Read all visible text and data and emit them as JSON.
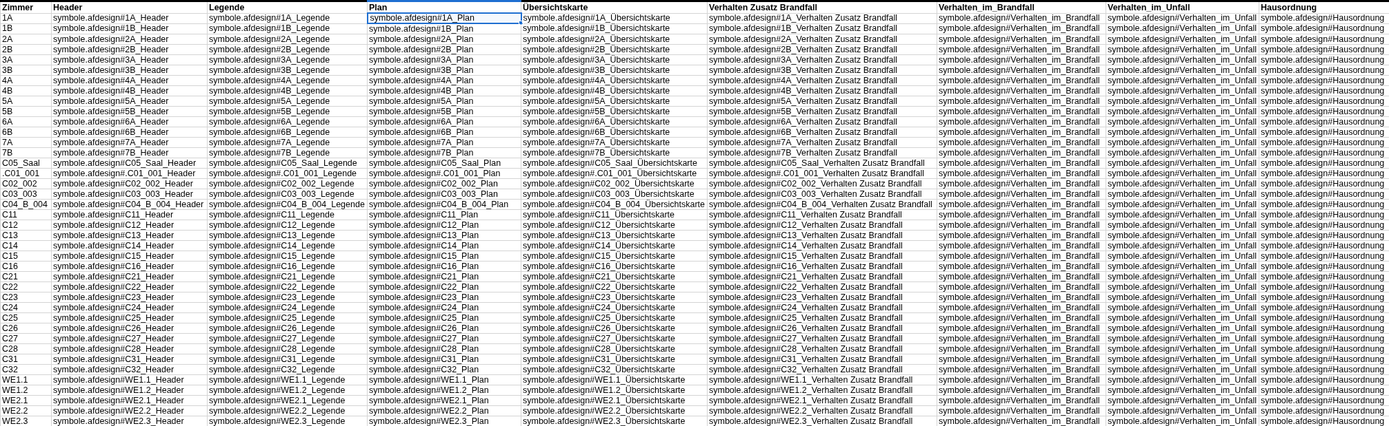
{
  "table": {
    "columns": [
      {
        "label": "Zimmer",
        "selected": false
      },
      {
        "label": "Header",
        "selected": false
      },
      {
        "label": "Legende",
        "selected": false
      },
      {
        "label": "Plan",
        "selected": true
      },
      {
        "label": "Übersichtskarte",
        "selected": false
      },
      {
        "label": "Verhalten Zusatz Brandfall",
        "selected": false
      },
      {
        "label": "Verhalten_im_Brandfall",
        "selected": false
      },
      {
        "label": "Verhalten_im_Unfall",
        "selected": false
      },
      {
        "label": "Hausordnung",
        "selected": false
      }
    ],
    "rows": [
      {
        "selected": true,
        "cells": [
          "1A",
          "symbole.afdesign#1A_Header",
          "symbole.afdesign#1A_Legende",
          "symbole.afdesign#1A_Plan",
          "symbole.afdesign#1A_Übersichtskarte",
          "symbole.afdesign#1A_Verhalten Zusatz Brandfall",
          "symbole.afdesign#Verhalten_im_Brandfall",
          "symbole.afdesign#Verhalten_im_Unfall",
          "symbole.afdesign#Hausordnung"
        ]
      },
      {
        "selected": false,
        "cells": [
          "1B",
          "symbole.afdesign#1B_Header",
          "symbole.afdesign#1B_Legende",
          "symbole.afdesign#1B_Plan",
          "symbole.afdesign#1B_Übersichtskarte",
          "symbole.afdesign#1B_Verhalten Zusatz Brandfall",
          "symbole.afdesign#Verhalten_im_Brandfall",
          "symbole.afdesign#Verhalten_im_Unfall",
          "symbole.afdesign#Hausordnung"
        ]
      },
      {
        "selected": false,
        "cells": [
          "2A",
          "symbole.afdesign#2A_Header",
          "symbole.afdesign#2A_Legende",
          "symbole.afdesign#2A_Plan",
          "symbole.afdesign#2A_Übersichtskarte",
          "symbole.afdesign#2A_Verhalten Zusatz Brandfall",
          "symbole.afdesign#Verhalten_im_Brandfall",
          "symbole.afdesign#Verhalten_im_Unfall",
          "symbole.afdesign#Hausordnung"
        ]
      },
      {
        "selected": false,
        "cells": [
          "2B",
          "symbole.afdesign#2B_Header",
          "symbole.afdesign#2B_Legende",
          "symbole.afdesign#2B_Plan",
          "symbole.afdesign#2B_Übersichtskarte",
          "symbole.afdesign#2B_Verhalten Zusatz Brandfall",
          "symbole.afdesign#Verhalten_im_Brandfall",
          "symbole.afdesign#Verhalten_im_Unfall",
          "symbole.afdesign#Hausordnung"
        ]
      },
      {
        "selected": false,
        "cells": [
          "3A",
          "symbole.afdesign#3A_Header",
          "symbole.afdesign#3A_Legende",
          "symbole.afdesign#3A_Plan",
          "symbole.afdesign#3A_Übersichtskarte",
          "symbole.afdesign#3A_Verhalten Zusatz Brandfall",
          "symbole.afdesign#Verhalten_im_Brandfall",
          "symbole.afdesign#Verhalten_im_Unfall",
          "symbole.afdesign#Hausordnung"
        ]
      },
      {
        "selected": false,
        "cells": [
          "3B",
          "symbole.afdesign#3B_Header",
          "symbole.afdesign#3B_Legende",
          "symbole.afdesign#3B_Plan",
          "symbole.afdesign#3B_Übersichtskarte",
          "symbole.afdesign#3B_Verhalten Zusatz Brandfall",
          "symbole.afdesign#Verhalten_im_Brandfall",
          "symbole.afdesign#Verhalten_im_Unfall",
          "symbole.afdesign#Hausordnung"
        ]
      },
      {
        "selected": false,
        "cells": [
          "4A",
          "symbole.afdesign#4A_Header",
          "symbole.afdesign#4A_Legende",
          "symbole.afdesign#4A_Plan",
          "symbole.afdesign#4A_Übersichtskarte",
          "symbole.afdesign#4A_Verhalten Zusatz Brandfall",
          "symbole.afdesign#Verhalten_im_Brandfall",
          "symbole.afdesign#Verhalten_im_Unfall",
          "symbole.afdesign#Hausordnung"
        ]
      },
      {
        "selected": false,
        "cells": [
          "4B",
          "symbole.afdesign#4B_Header",
          "symbole.afdesign#4B_Legende",
          "symbole.afdesign#4B_Plan",
          "symbole.afdesign#4B_Übersichtskarte",
          "symbole.afdesign#4B_Verhalten Zusatz Brandfall",
          "symbole.afdesign#Verhalten_im_Brandfall",
          "symbole.afdesign#Verhalten_im_Unfall",
          "symbole.afdesign#Hausordnung"
        ]
      },
      {
        "selected": false,
        "cells": [
          "5A",
          "symbole.afdesign#5A_Header",
          "symbole.afdesign#5A_Legende",
          "symbole.afdesign#5A_Plan",
          "symbole.afdesign#5A_Übersichtskarte",
          "symbole.afdesign#5A_Verhalten Zusatz Brandfall",
          "symbole.afdesign#Verhalten_im_Brandfall",
          "symbole.afdesign#Verhalten_im_Unfall",
          "symbole.afdesign#Hausordnung"
        ]
      },
      {
        "selected": false,
        "cells": [
          "5B",
          "symbole.afdesign#5B_Header",
          "symbole.afdesign#5B_Legende",
          "symbole.afdesign#5B_Plan",
          "symbole.afdesign#5B_Übersichtskarte",
          "symbole.afdesign#5B_Verhalten Zusatz Brandfall",
          "symbole.afdesign#Verhalten_im_Brandfall",
          "symbole.afdesign#Verhalten_im_Unfall",
          "symbole.afdesign#Hausordnung"
        ]
      },
      {
        "selected": false,
        "cells": [
          "6A",
          "symbole.afdesign#6A_Header",
          "symbole.afdesign#6A_Legende",
          "symbole.afdesign#6A_Plan",
          "symbole.afdesign#6A_Übersichtskarte",
          "symbole.afdesign#6A_Verhalten Zusatz Brandfall",
          "symbole.afdesign#Verhalten_im_Brandfall",
          "symbole.afdesign#Verhalten_im_Unfall",
          "symbole.afdesign#Hausordnung"
        ]
      },
      {
        "selected": false,
        "cells": [
          "6B",
          "symbole.afdesign#6B_Header",
          "symbole.afdesign#6B_Legende",
          "symbole.afdesign#6B_Plan",
          "symbole.afdesign#6B_Übersichtskarte",
          "symbole.afdesign#6B_Verhalten Zusatz Brandfall",
          "symbole.afdesign#Verhalten_im_Brandfall",
          "symbole.afdesign#Verhalten_im_Unfall",
          "symbole.afdesign#Hausordnung"
        ]
      },
      {
        "selected": false,
        "cells": [
          "7A",
          "symbole.afdesign#7A_Header",
          "symbole.afdesign#7A_Legende",
          "symbole.afdesign#7A_Plan",
          "symbole.afdesign#7A_Übersichtskarte",
          "symbole.afdesign#7A_Verhalten Zusatz Brandfall",
          "symbole.afdesign#Verhalten_im_Brandfall",
          "symbole.afdesign#Verhalten_im_Unfall",
          "symbole.afdesign#Hausordnung"
        ]
      },
      {
        "selected": false,
        "cells": [
          "7B",
          "symbole.afdesign#7B_Header",
          "symbole.afdesign#7B_Legende",
          "symbole.afdesign#7B_Plan",
          "symbole.afdesign#7B_Übersichtskarte",
          "symbole.afdesign#7B_Verhalten Zusatz Brandfall",
          "symbole.afdesign#Verhalten_im_Brandfall",
          "symbole.afdesign#Verhalten_im_Unfall",
          "symbole.afdesign#Hausordnung"
        ]
      },
      {
        "selected": false,
        "cells": [
          "C05_Saal",
          "symbole.afdesign#C05_Saal_Header",
          "symbole.afdesign#C05_Saal_Legende",
          "symbole.afdesign#C05_Saal_Plan",
          "symbole.afdesign#C05_Saal_Übersichtskarte",
          "symbole.afdesign#C05_Saal_Verhalten Zusatz Brandfall",
          "symbole.afdesign#Verhalten_im_Brandfall",
          "symbole.afdesign#Verhalten_im_Unfall",
          "symbole.afdesign#Hausordnung"
        ]
      },
      {
        "selected": false,
        "cells": [
          ".C01_001",
          "symbole.afdesign#.C01_001_Header",
          "symbole.afdesign#.C01_001_Legende",
          "symbole.afdesign#.C01_001_Plan",
          "symbole.afdesign#.C01_001_Übersichtskarte",
          "symbole.afdesign#.C01_001_Verhalten Zusatz Brandfall",
          "symbole.afdesign#Verhalten_im_Brandfall",
          "symbole.afdesign#Verhalten_im_Unfall",
          "symbole.afdesign#Hausordnung"
        ]
      },
      {
        "selected": false,
        "cells": [
          "C02_002",
          "symbole.afdesign#C02_002_Header",
          "symbole.afdesign#C02_002_Legende",
          "symbole.afdesign#C02_002_Plan",
          "symbole.afdesign#C02_002_Übersichtskarte",
          "symbole.afdesign#C02_002_Verhalten Zusatz Brandfall",
          "symbole.afdesign#Verhalten_im_Brandfall",
          "symbole.afdesign#Verhalten_im_Unfall",
          "symbole.afdesign#Hausordnung"
        ]
      },
      {
        "selected": false,
        "cells": [
          "C03_003",
          "symbole.afdesign#C03_003_Header",
          "symbole.afdesign#C03_003_Legende",
          "symbole.afdesign#C03_003_Plan",
          "symbole.afdesign#C03_003_Übersichtskarte",
          "symbole.afdesign#C03_003_Verhalten Zusatz Brandfall",
          "symbole.afdesign#Verhalten_im_Brandfall",
          "symbole.afdesign#Verhalten_im_Unfall",
          "symbole.afdesign#Hausordnung"
        ]
      },
      {
        "selected": false,
        "cells": [
          "C04_B_004",
          "symbole.afdesign#C04_B_004_Header",
          "symbole.afdesign#C04_B_004_Legende",
          "symbole.afdesign#C04_B_004_Plan",
          "symbole.afdesign#C04_B_004_Übersichtskarte",
          "symbole.afdesign#C04_B_004_Verhalten Zusatz Brandfall",
          "symbole.afdesign#Verhalten_im_Brandfall",
          "symbole.afdesign#Verhalten_im_Unfall",
          "symbole.afdesign#Hausordnung"
        ]
      },
      {
        "selected": false,
        "cells": [
          "C11",
          "symbole.afdesign#C11_Header",
          "symbole.afdesign#C11_Legende",
          "symbole.afdesign#C11_Plan",
          "symbole.afdesign#C11_Übersichtskarte",
          "symbole.afdesign#C11_Verhalten Zusatz Brandfall",
          "symbole.afdesign#Verhalten_im_Brandfall",
          "symbole.afdesign#Verhalten_im_Unfall",
          "symbole.afdesign#Hausordnung"
        ]
      },
      {
        "selected": false,
        "cells": [
          "C12",
          "symbole.afdesign#C12_Header",
          "symbole.afdesign#C12_Legende",
          "symbole.afdesign#C12_Plan",
          "symbole.afdesign#C12_Übersichtskarte",
          "symbole.afdesign#C12_Verhalten Zusatz Brandfall",
          "symbole.afdesign#Verhalten_im_Brandfall",
          "symbole.afdesign#Verhalten_im_Unfall",
          "symbole.afdesign#Hausordnung"
        ]
      },
      {
        "selected": false,
        "cells": [
          "C13",
          "symbole.afdesign#C13_Header",
          "symbole.afdesign#C13_Legende",
          "symbole.afdesign#C13_Plan",
          "symbole.afdesign#C13_Übersichtskarte",
          "symbole.afdesign#C13_Verhalten Zusatz Brandfall",
          "symbole.afdesign#Verhalten_im_Brandfall",
          "symbole.afdesign#Verhalten_im_Unfall",
          "symbole.afdesign#Hausordnung"
        ]
      },
      {
        "selected": false,
        "cells": [
          "C14",
          "symbole.afdesign#C14_Header",
          "symbole.afdesign#C14_Legende",
          "symbole.afdesign#C14_Plan",
          "symbole.afdesign#C14_Übersichtskarte",
          "symbole.afdesign#C14_Verhalten Zusatz Brandfall",
          "symbole.afdesign#Verhalten_im_Brandfall",
          "symbole.afdesign#Verhalten_im_Unfall",
          "symbole.afdesign#Hausordnung"
        ]
      },
      {
        "selected": false,
        "cells": [
          "C15",
          "symbole.afdesign#C15_Header",
          "symbole.afdesign#C15_Legende",
          "symbole.afdesign#C15_Plan",
          "symbole.afdesign#C15_Übersichtskarte",
          "symbole.afdesign#C15_Verhalten Zusatz Brandfall",
          "symbole.afdesign#Verhalten_im_Brandfall",
          "symbole.afdesign#Verhalten_im_Unfall",
          "symbole.afdesign#Hausordnung"
        ]
      },
      {
        "selected": false,
        "cells": [
          "C16",
          "symbole.afdesign#C16_Header",
          "symbole.afdesign#C16_Legende",
          "symbole.afdesign#C16_Plan",
          "symbole.afdesign#C16_Übersichtskarte",
          "symbole.afdesign#C16_Verhalten Zusatz Brandfall",
          "symbole.afdesign#Verhalten_im_Brandfall",
          "symbole.afdesign#Verhalten_im_Unfall",
          "symbole.afdesign#Hausordnung"
        ]
      },
      {
        "selected": false,
        "cells": [
          "C21",
          "symbole.afdesign#C21_Header",
          "symbole.afdesign#C21_Legende",
          "symbole.afdesign#C21_Plan",
          "symbole.afdesign#C21_Übersichtskarte",
          "symbole.afdesign#C21_Verhalten Zusatz Brandfall",
          "symbole.afdesign#Verhalten_im_Brandfall",
          "symbole.afdesign#Verhalten_im_Unfall",
          "symbole.afdesign#Hausordnung"
        ]
      },
      {
        "selected": false,
        "cells": [
          "C22",
          "symbole.afdesign#C22_Header",
          "symbole.afdesign#C22_Legende",
          "symbole.afdesign#C22_Plan",
          "symbole.afdesign#C22_Übersichtskarte",
          "symbole.afdesign#C22_Verhalten Zusatz Brandfall",
          "symbole.afdesign#Verhalten_im_Brandfall",
          "symbole.afdesign#Verhalten_im_Unfall",
          "symbole.afdesign#Hausordnung"
        ]
      },
      {
        "selected": false,
        "cells": [
          "C23",
          "symbole.afdesign#C23_Header",
          "symbole.afdesign#C23_Legende",
          "symbole.afdesign#C23_Plan",
          "symbole.afdesign#C23_Übersichtskarte",
          "symbole.afdesign#C23_Verhalten Zusatz Brandfall",
          "symbole.afdesign#Verhalten_im_Brandfall",
          "symbole.afdesign#Verhalten_im_Unfall",
          "symbole.afdesign#Hausordnung"
        ]
      },
      {
        "selected": false,
        "cells": [
          "C24",
          "symbole.afdesign#C24_Header",
          "symbole.afdesign#C24_Legende",
          "symbole.afdesign#C24_Plan",
          "symbole.afdesign#C24_Übersichtskarte",
          "symbole.afdesign#C24_Verhalten Zusatz Brandfall",
          "symbole.afdesign#Verhalten_im_Brandfall",
          "symbole.afdesign#Verhalten_im_Unfall",
          "symbole.afdesign#Hausordnung"
        ]
      },
      {
        "selected": false,
        "cells": [
          "C25",
          "symbole.afdesign#C25_Header",
          "symbole.afdesign#C25_Legende",
          "symbole.afdesign#C25_Plan",
          "symbole.afdesign#C25_Übersichtskarte",
          "symbole.afdesign#C25_Verhalten Zusatz Brandfall",
          "symbole.afdesign#Verhalten_im_Brandfall",
          "symbole.afdesign#Verhalten_im_Unfall",
          "symbole.afdesign#Hausordnung"
        ]
      },
      {
        "selected": false,
        "cells": [
          "C26",
          "symbole.afdesign#C26_Header",
          "symbole.afdesign#C26_Legende",
          "symbole.afdesign#C26_Plan",
          "symbole.afdesign#C26_Übersichtskarte",
          "symbole.afdesign#C26_Verhalten Zusatz Brandfall",
          "symbole.afdesign#Verhalten_im_Brandfall",
          "symbole.afdesign#Verhalten_im_Unfall",
          "symbole.afdesign#Hausordnung"
        ]
      },
      {
        "selected": false,
        "cells": [
          "C27",
          "symbole.afdesign#C27_Header",
          "symbole.afdesign#C27_Legende",
          "symbole.afdesign#C27_Plan",
          "symbole.afdesign#C27_Übersichtskarte",
          "symbole.afdesign#C27_Verhalten Zusatz Brandfall",
          "symbole.afdesign#Verhalten_im_Brandfall",
          "symbole.afdesign#Verhalten_im_Unfall",
          "symbole.afdesign#Hausordnung"
        ]
      },
      {
        "selected": false,
        "cells": [
          "C28",
          "symbole.afdesign#C28_Header",
          "symbole.afdesign#C28_Legende",
          "symbole.afdesign#C28_Plan",
          "symbole.afdesign#C28_Übersichtskarte",
          "symbole.afdesign#C28_Verhalten Zusatz Brandfall",
          "symbole.afdesign#Verhalten_im_Brandfall",
          "symbole.afdesign#Verhalten_im_Unfall",
          "symbole.afdesign#Hausordnung"
        ]
      },
      {
        "selected": false,
        "cells": [
          "C31",
          "symbole.afdesign#C31_Header",
          "symbole.afdesign#C31_Legende",
          "symbole.afdesign#C31_Plan",
          "symbole.afdesign#C31_Übersichtskarte",
          "symbole.afdesign#C31_Verhalten Zusatz Brandfall",
          "symbole.afdesign#Verhalten_im_Brandfall",
          "symbole.afdesign#Verhalten_im_Unfall",
          "symbole.afdesign#Hausordnung"
        ]
      },
      {
        "selected": false,
        "cells": [
          "C32",
          "symbole.afdesign#C32_Header",
          "symbole.afdesign#C32_Legende",
          "symbole.afdesign#C32_Plan",
          "symbole.afdesign#C32_Übersichtskarte",
          "symbole.afdesign#C32_Verhalten Zusatz Brandfall",
          "symbole.afdesign#Verhalten_im_Brandfall",
          "symbole.afdesign#Verhalten_im_Unfall",
          "symbole.afdesign#Hausordnung"
        ]
      },
      {
        "selected": false,
        "cells": [
          "WE1.1",
          "symbole.afdesign#WE1.1_Header",
          "symbole.afdesign#WE1.1_Legende",
          "symbole.afdesign#WE1.1_Plan",
          "symbole.afdesign#WE1.1_Übersichtskarte",
          "symbole.afdesign#WE1.1_Verhalten Zusatz Brandfall",
          "symbole.afdesign#Verhalten_im_Brandfall",
          "symbole.afdesign#Verhalten_im_Unfall",
          "symbole.afdesign#Hausordnung"
        ]
      },
      {
        "selected": false,
        "cells": [
          "WE1.2",
          "symbole.afdesign#WE1.2_Header",
          "symbole.afdesign#WE1.2_Legende",
          "symbole.afdesign#WE1.2_Plan",
          "symbole.afdesign#WE1.2_Übersichtskarte",
          "symbole.afdesign#WE1.2_Verhalten Zusatz Brandfall",
          "symbole.afdesign#Verhalten_im_Brandfall",
          "symbole.afdesign#Verhalten_im_Unfall",
          "symbole.afdesign#Hausordnung"
        ]
      },
      {
        "selected": false,
        "cells": [
          "WE2.1",
          "symbole.afdesign#WE2.1_Header",
          "symbole.afdesign#WE2.1_Legende",
          "symbole.afdesign#WE2.1_Plan",
          "symbole.afdesign#WE2.1_Übersichtskarte",
          "symbole.afdesign#WE2.1_Verhalten Zusatz Brandfall",
          "symbole.afdesign#Verhalten_im_Brandfall",
          "symbole.afdesign#Verhalten_im_Unfall",
          "symbole.afdesign#Hausordnung"
        ]
      },
      {
        "selected": false,
        "cells": [
          "WE2.2",
          "symbole.afdesign#WE2.2_Header",
          "symbole.afdesign#WE2.2_Legende",
          "symbole.afdesign#WE2.2_Plan",
          "symbole.afdesign#WE2.2_Übersichtskarte",
          "symbole.afdesign#WE2.2_Verhalten Zusatz Brandfall",
          "symbole.afdesign#Verhalten_im_Brandfall",
          "symbole.afdesign#Verhalten_im_Unfall",
          "symbole.afdesign#Hausordnung"
        ]
      },
      {
        "selected": false,
        "cells": [
          "WE2.3",
          "symbole.afdesign#WE2.3_Header",
          "symbole.afdesign#WE2.3_Legende",
          "symbole.afdesign#WE2.3_Plan",
          "symbole.afdesign#WE2.3_Übersichtskarte",
          "symbole.afdesign#WE2.3_Verhalten Zusatz Brandfall",
          "symbole.afdesign#Verhalten_im_Brandfall",
          "symbole.afdesign#Verhalten_im_Unfall",
          "symbole.afdesign#Hausordnung"
        ]
      }
    ]
  }
}
